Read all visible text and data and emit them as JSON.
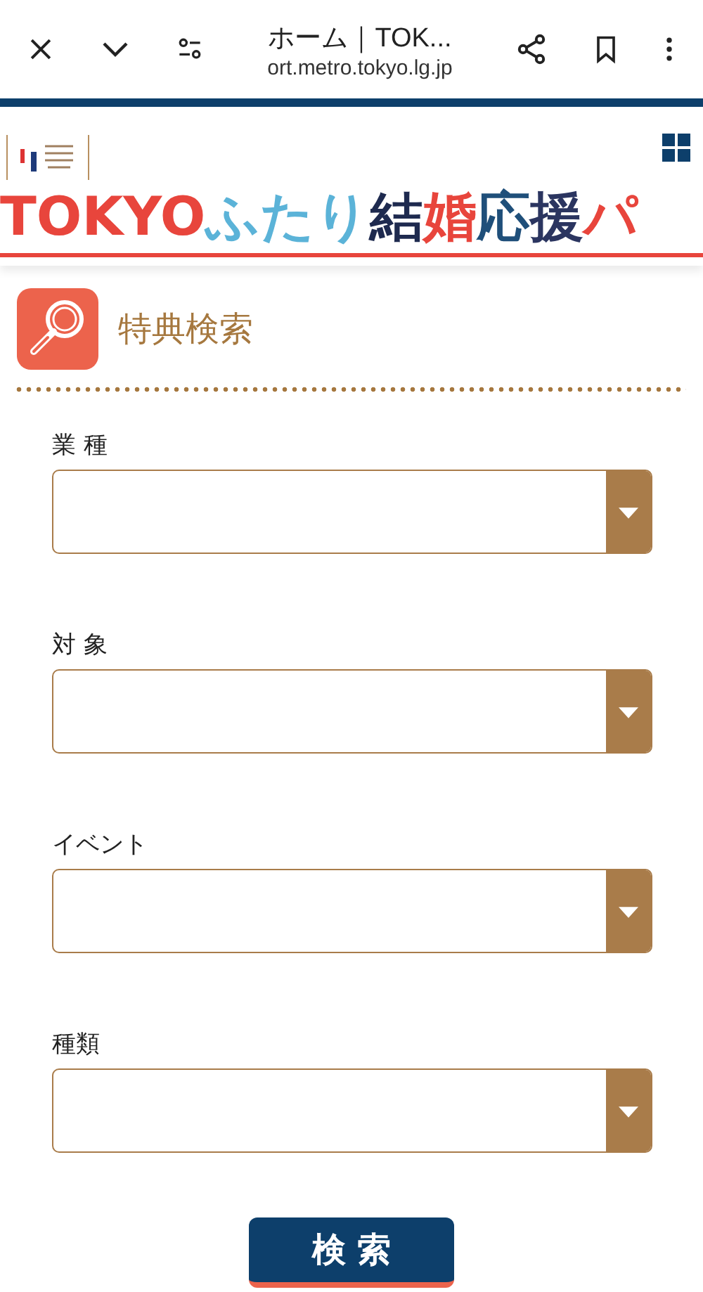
{
  "browser_bar": {
    "title": "ホーム｜TOK...",
    "url": "ort.metro.tokyo.lg.jp"
  },
  "banner": {
    "segments": [
      {
        "text": "TOKYO",
        "color": "#e8453c"
      },
      {
        "text": "ふたり",
        "color": "#5bb3d8"
      },
      {
        "text": "結",
        "color": "#1e2a4f"
      },
      {
        "text": "婚",
        "color": "#e8453c"
      },
      {
        "text": "応",
        "color": "#1f4f7a"
      },
      {
        "text": "援",
        "color": "#2b3560"
      },
      {
        "text": "パ",
        "color": "#e8453c"
      }
    ]
  },
  "section": {
    "title": "特典検索"
  },
  "fields": [
    {
      "label": "業 種"
    },
    {
      "label": "対 象"
    },
    {
      "label": "イベント"
    },
    {
      "label": "種類"
    }
  ],
  "search_button": {
    "label": "検 索"
  }
}
